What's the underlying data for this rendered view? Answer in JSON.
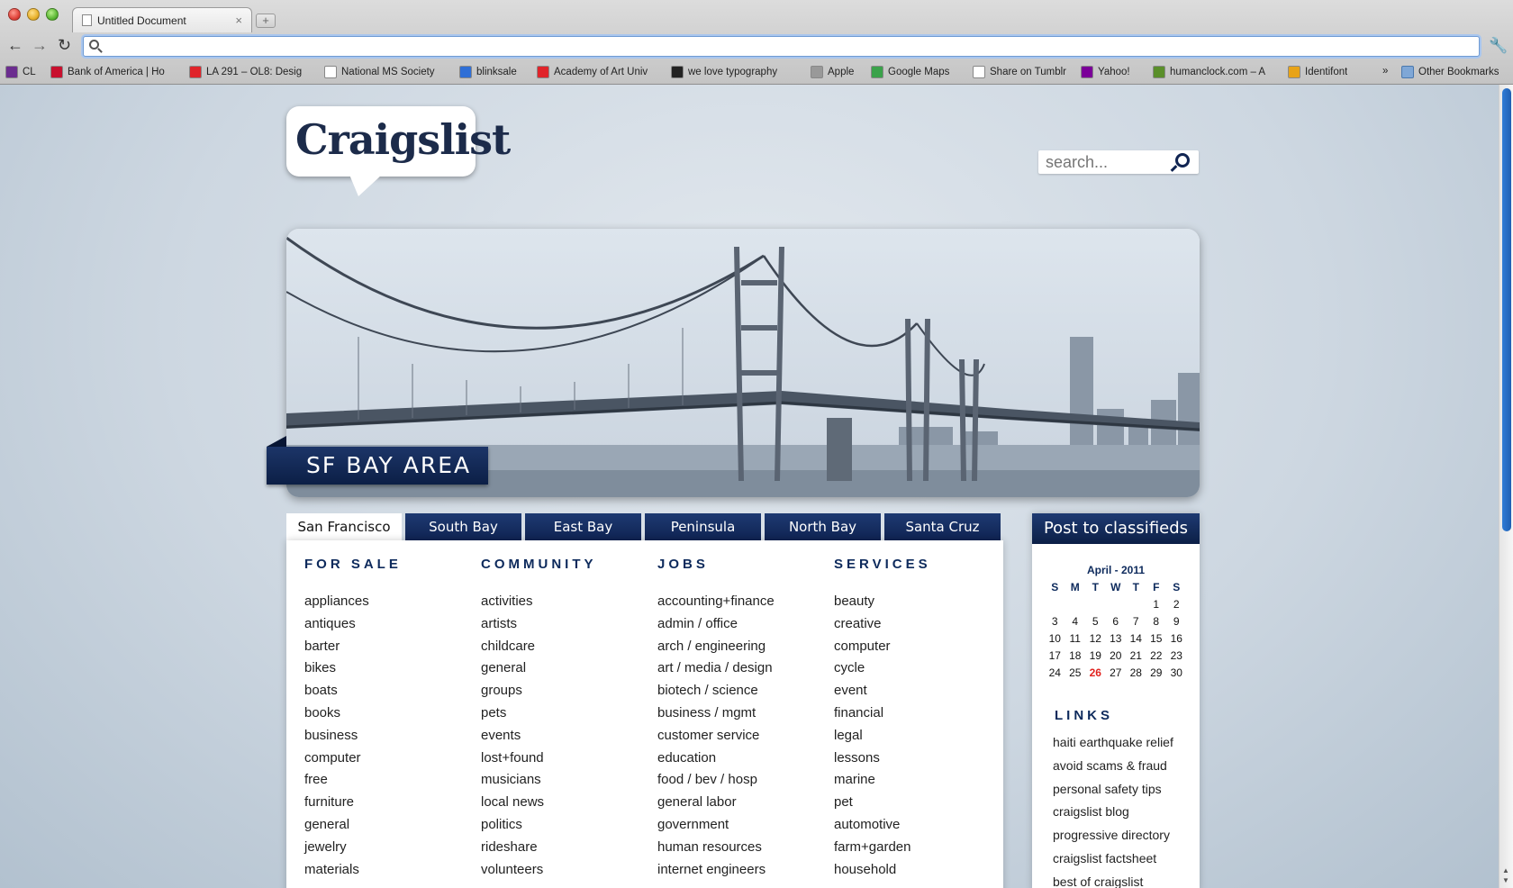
{
  "browser": {
    "tab_title": "Untitled Document",
    "tab_close": "×",
    "new_tab": "+",
    "address_value": "",
    "bookmarks": [
      {
        "label": "CL",
        "icon": "peace-icon",
        "color": "#6b2d8f"
      },
      {
        "label": "Bank of America | Ho",
        "icon": "bofa-icon",
        "color": "#c8102e"
      },
      {
        "label": "LA 291 – OL8: Desig",
        "icon": "academy-icon",
        "color": "#e0242a"
      },
      {
        "label": "National MS Society",
        "icon": "blank-page-icon",
        "color": "#ffffff"
      },
      {
        "label": "blinksale",
        "icon": "blinksale-icon",
        "color": "#2f6fd6"
      },
      {
        "label": "Academy of Art Univ",
        "icon": "academy-icon",
        "color": "#e0242a"
      },
      {
        "label": "we love typography",
        "icon": "wlt-icon",
        "color": "#222222"
      },
      {
        "label": "Apple",
        "icon": "apple-icon",
        "color": "#999999"
      },
      {
        "label": "Google Maps",
        "icon": "google-maps-icon",
        "color": "#3aa24a"
      },
      {
        "label": "Share on Tumblr",
        "icon": "blank-page-icon",
        "color": "#ffffff"
      },
      {
        "label": "Yahoo!",
        "icon": "yahoo-icon",
        "color": "#7b0099"
      },
      {
        "label": "humanclock.com – A",
        "icon": "humanclock-icon",
        "color": "#5a8f2a"
      },
      {
        "label": "Identifont",
        "icon": "identifont-icon",
        "color": "#e8a317"
      }
    ],
    "bookmarks_overflow": "»",
    "other_bookmarks": "Other Bookmarks"
  },
  "site": {
    "logo": "Craigslist",
    "search_placeholder": "search...",
    "hero_label": "SF BAY AREA",
    "area_tabs": [
      "San Francisco",
      "South Bay",
      "East Bay",
      "Peninsula",
      "North Bay",
      "Santa Cruz"
    ],
    "columns": [
      {
        "heading": "FOR SALE",
        "items": [
          "appliances",
          "antiques",
          "barter",
          "bikes",
          "boats",
          "books",
          "business",
          "computer",
          "free",
          "furniture",
          "general",
          "jewelry",
          "materials"
        ]
      },
      {
        "heading": "COMMUNITY",
        "items": [
          "activities",
          "artists",
          "childcare",
          "general",
          "groups",
          "pets",
          "events",
          "lost+found",
          "musicians",
          "local news",
          "politics",
          "rideshare",
          "volunteers"
        ]
      },
      {
        "heading": "JOBS",
        "items": [
          "accounting+finance",
          "admin / office",
          "arch / engineering",
          "art / media / design",
          "biotech / science",
          "business / mgmt",
          "customer service",
          "education",
          "food / bev / hosp",
          "general labor",
          "government",
          "human resources",
          "internet engineers"
        ]
      },
      {
        "heading": "SERVICES",
        "items": [
          "beauty",
          "creative",
          "computer",
          "cycle",
          "event",
          "financial",
          "legal",
          "lessons",
          "marine",
          "pet",
          "automotive",
          "farm+garden",
          "household"
        ]
      }
    ],
    "post_button": "Post to classifieds",
    "calendar": {
      "title": "April - 2011",
      "weekdays": [
        "S",
        "M",
        "T",
        "W",
        "T",
        "F",
        "S"
      ],
      "weeks": [
        [
          "",
          "",
          "",
          "",
          "",
          "1",
          "2"
        ],
        [
          "3",
          "4",
          "5",
          "6",
          "7",
          "8",
          "9"
        ],
        [
          "10",
          "11",
          "12",
          "13",
          "14",
          "15",
          "16"
        ],
        [
          "17",
          "18",
          "19",
          "20",
          "21",
          "22",
          "23"
        ],
        [
          "24",
          "25",
          "26",
          "27",
          "28",
          "29",
          "30"
        ]
      ],
      "today": "26",
      "today_color": "#e12420"
    },
    "links_heading": "LINKS",
    "links": [
      "haiti earthquake relief",
      "avoid scams & fraud",
      "personal safety tips",
      "craigslist blog",
      "progressive directory",
      "craigslist factsheet",
      "best of craigslist"
    ]
  }
}
